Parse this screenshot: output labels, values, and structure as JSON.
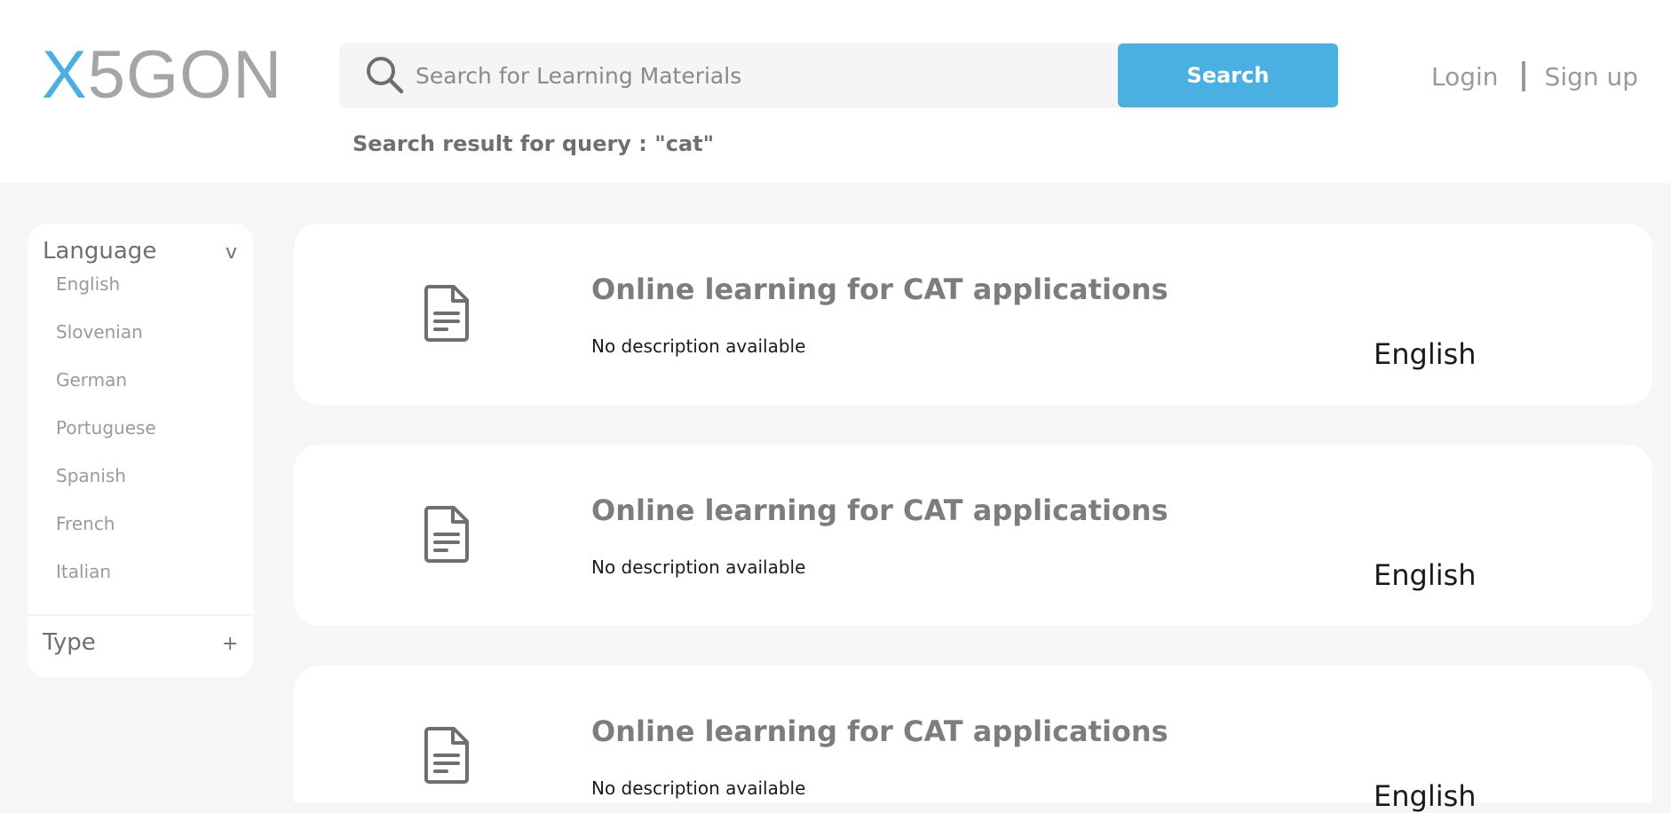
{
  "header": {
    "logo": {
      "first": "X",
      "rest": "5GON"
    },
    "search": {
      "placeholder": "Search for Learning Materials",
      "value": "",
      "button_label": "Search"
    },
    "auth": {
      "login": "Login",
      "signup": "Sign up"
    },
    "query_text": "Search result for query : \"cat\""
  },
  "sidebar": {
    "language_title": "Language",
    "language_toggle": "v",
    "languages": [
      "English",
      "Slovenian",
      "German",
      "Portuguese",
      "Spanish",
      "French",
      "Italian"
    ],
    "type_title": "Type",
    "type_toggle": "+"
  },
  "results": [
    {
      "icon": "document-icon",
      "title": "Online learning for CAT applications",
      "description": "No description available",
      "language": "English"
    },
    {
      "icon": "document-icon",
      "title": "Online learning for CAT applications",
      "description": "No description available",
      "language": "English"
    },
    {
      "icon": "document-icon",
      "title": "Online learning for CAT applications",
      "description": "No description available",
      "language": "English"
    }
  ],
  "colors": {
    "accent": "#4aafe1",
    "logo_gray": "#a5a5a5",
    "page_background": "#f7f6f6"
  }
}
